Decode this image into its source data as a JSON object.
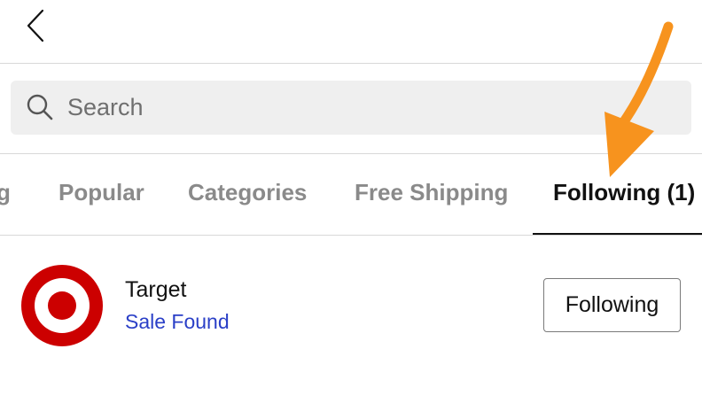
{
  "search": {
    "placeholder": "Search"
  },
  "tabs": [
    {
      "label": "g"
    },
    {
      "label": "Popular"
    },
    {
      "label": "Categories"
    },
    {
      "label": "Free Shipping"
    },
    {
      "label": "Following (1)"
    }
  ],
  "stores": [
    {
      "name": "Target",
      "status": "Sale Found",
      "button_label": "Following"
    }
  ],
  "colors": {
    "accent_link": "#2a3fc7",
    "brand_target_red": "#cc0000",
    "annotation_arrow": "#f7931e"
  },
  "icons": {
    "back": "chevron-left-icon",
    "search": "search-icon",
    "annotation": "arrow-annotation-icon"
  }
}
